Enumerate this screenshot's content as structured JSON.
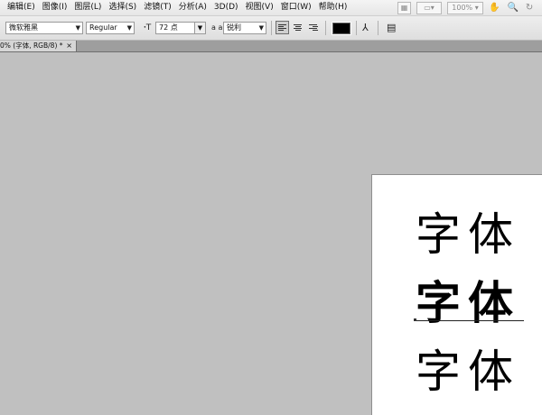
{
  "menubar": {
    "items": [
      "编辑(E)",
      "图像(I)",
      "图层(L)",
      "选择(S)",
      "滤镜(T)",
      "分析(A)",
      "3D(D)",
      "视图(V)",
      "窗口(W)",
      "帮助(H)"
    ],
    "zoom": "100%"
  },
  "options": {
    "font_family": "微软雅黑",
    "font_style": "Regular",
    "font_size": "72 点",
    "aa_icon_label": "a a",
    "anti_alias": "锐利",
    "text_color": "#000000"
  },
  "document": {
    "tab_label": "0% (字体, RGB/8) *",
    "close_glyph": "×",
    "samples": [
      "字体",
      "字体",
      "字体"
    ]
  }
}
